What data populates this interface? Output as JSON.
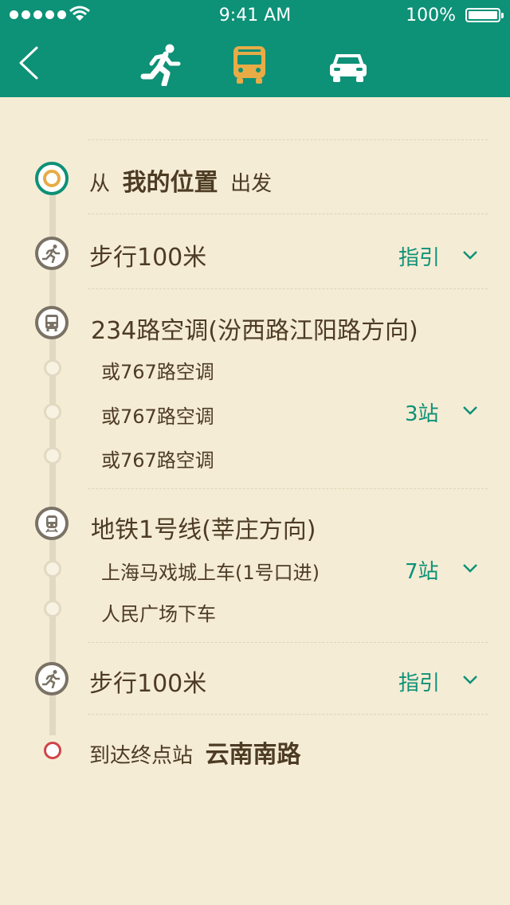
{
  "status_bar": {
    "time": "9:41 AM",
    "battery": "100%"
  },
  "nav": {
    "modes": [
      {
        "name": "walk",
        "icon": "walk-icon",
        "selected": false
      },
      {
        "name": "bus",
        "icon": "bus-icon",
        "selected": true
      },
      {
        "name": "car",
        "icon": "car-icon",
        "selected": false
      }
    ],
    "colors": {
      "header": "#0d9177",
      "selected": "#e8ab46",
      "background": "#f5ecd5"
    }
  },
  "route": {
    "start": {
      "prefix": "从",
      "place": "我的位置",
      "suffix": "出发"
    },
    "walk1": {
      "label": "步行100米",
      "action": "指引"
    },
    "bus": {
      "title": "234路空调(汾西路江阳路方向)",
      "alts": [
        "或767路空调",
        "或767路空调",
        "或767路空调"
      ],
      "stops": "3站"
    },
    "metro": {
      "title": "地铁1号线(莘庄方向)",
      "board": "上海马戏城上车(1号口进)",
      "alight": "人民广场下车",
      "stops": "7站"
    },
    "walk2": {
      "label": "步行100米",
      "action": "指引"
    },
    "end": {
      "prefix": "到达终点站",
      "place": "云南南路"
    }
  }
}
